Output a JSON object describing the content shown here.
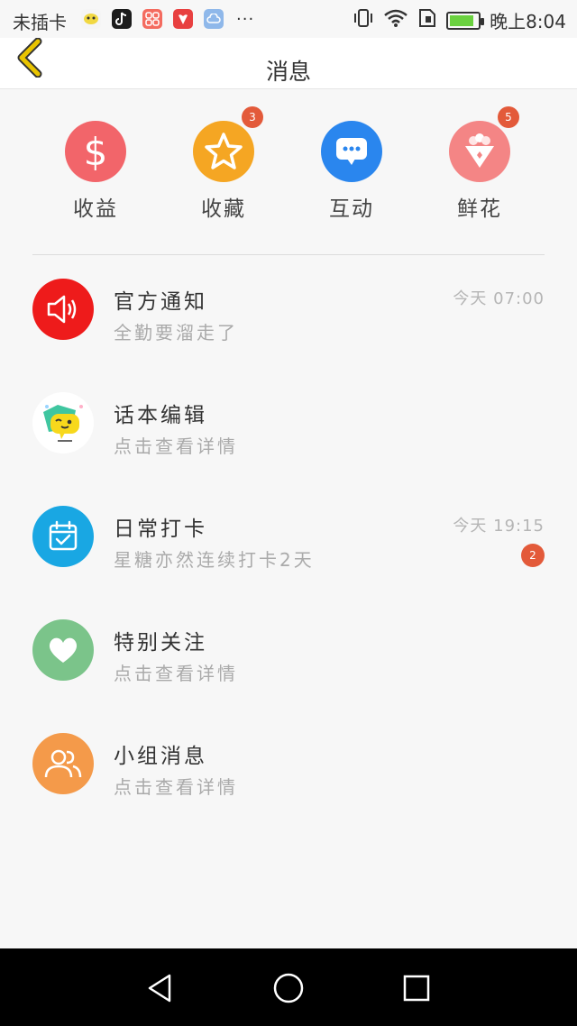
{
  "status_bar": {
    "carrier": "未插卡",
    "app_icons": [
      {
        "name": "bird-app-icon",
        "color": "#f5f5f5"
      },
      {
        "name": "tiktok-app-icon",
        "color": "#1c1c1c"
      },
      {
        "name": "grid-app-icon",
        "color": "#f46b5f"
      },
      {
        "name": "huawei-app-icon",
        "color": "#e84040"
      },
      {
        "name": "cloud-app-icon",
        "color": "#8fb8ea"
      }
    ],
    "more": "···",
    "time": "晚上8:04",
    "battery_level": 0.85,
    "battery_color": "#6ad13f"
  },
  "header": {
    "title": "消息",
    "back_icon_color": "#e9c400"
  },
  "quick_tiles": [
    {
      "label": "收益",
      "icon": "dollar-icon",
      "color": "#f2656a",
      "badge": ""
    },
    {
      "label": "收藏",
      "icon": "star-icon",
      "color": "#f5a623",
      "badge": "3"
    },
    {
      "label": "互动",
      "icon": "chat-bubble-icon",
      "color": "#2a86ee",
      "badge": ""
    },
    {
      "label": "鲜花",
      "icon": "flower-bouquet-icon",
      "color": "#f48585",
      "badge": "5"
    }
  ],
  "messages": [
    {
      "name": "官方通知",
      "preview": "全勤要溜走了",
      "time": "今天 07:00",
      "count": "",
      "icon": "speaker-icon",
      "color": "#ee1b1b"
    },
    {
      "name": "话本编辑",
      "preview": "点击查看详情",
      "time": "",
      "count": "",
      "icon": "cartoon-chat-icon",
      "color": "#ffffff"
    },
    {
      "name": "日常打卡",
      "preview": "星糖亦然连续打卡2天",
      "time": "今天 19:15",
      "count": "2",
      "icon": "calendar-check-icon",
      "color": "#19a7e3"
    },
    {
      "name": "特别关注",
      "preview": "点击查看详情",
      "time": "",
      "count": "",
      "icon": "heart-icon",
      "color": "#7bc48a"
    },
    {
      "name": "小组消息",
      "preview": "点击查看详情",
      "time": "",
      "count": "",
      "icon": "group-icon",
      "color": "#f49a4a"
    }
  ],
  "colors": {
    "badge": "#e35a3a",
    "background": "#f7f7f7"
  }
}
